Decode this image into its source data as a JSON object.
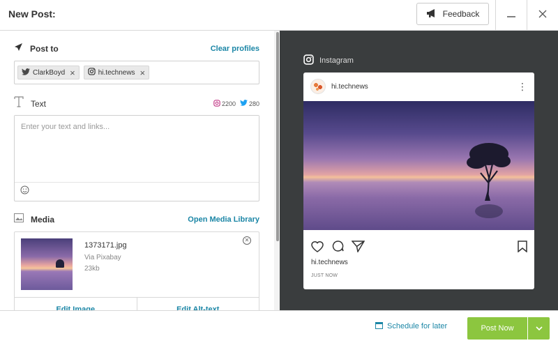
{
  "header": {
    "title": "New Post:",
    "feedback_label": "Feedback"
  },
  "post_to": {
    "label": "Post to",
    "clear_label": "Clear profiles",
    "profiles": [
      {
        "name": "ClarkBoyd",
        "network": "twitter"
      },
      {
        "name": "hi.technews",
        "network": "instagram"
      }
    ]
  },
  "text": {
    "label": "Text",
    "placeholder": "Enter your text and links...",
    "value": "",
    "instagram_limit": "2200",
    "twitter_limit": "280"
  },
  "media": {
    "label": "Media",
    "library_label": "Open Media Library",
    "file_name": "1373171.jpg",
    "source": "Via Pixabay",
    "size": "23kb",
    "edit_image_label": "Edit Image",
    "edit_alt_label": "Edit Alt-text"
  },
  "preview": {
    "platform": "Instagram",
    "username": "hi.technews",
    "caption_user": "hi.technews",
    "timestamp": "JUST NOW"
  },
  "footer": {
    "schedule_label": "Schedule for later",
    "post_now_label": "Post Now"
  },
  "colors": {
    "link": "#1b86a6",
    "post_button": "#8cc63f",
    "preview_bg": "#3a3d3e",
    "instagram_pink": "#c13584",
    "twitter_blue": "#1da1f2"
  }
}
